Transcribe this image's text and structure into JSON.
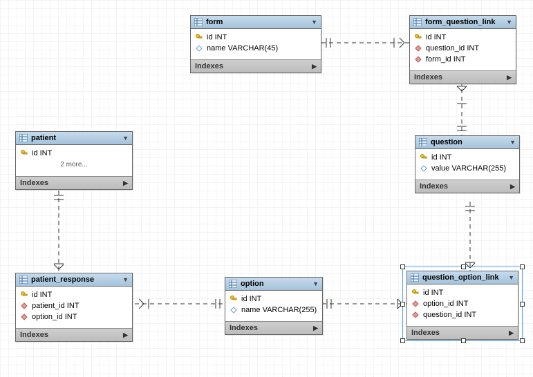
{
  "entities": {
    "form": {
      "name": "form",
      "cols": [
        {
          "sym": "key",
          "text": "id INT"
        },
        {
          "sym": "diamond",
          "text": "name VARCHAR(45)"
        }
      ]
    },
    "form_question_link": {
      "name": "form_question_link",
      "cols": [
        {
          "sym": "key",
          "text": "id INT"
        },
        {
          "sym": "fk",
          "text": "question_id INT"
        },
        {
          "sym": "fk",
          "text": "form_id INT"
        }
      ]
    },
    "patient": {
      "name": "patient",
      "cols": [
        {
          "sym": "key",
          "text": "id INT"
        }
      ],
      "more": "2 more..."
    },
    "question": {
      "name": "question",
      "cols": [
        {
          "sym": "key",
          "text": "id INT"
        },
        {
          "sym": "diamond",
          "text": "value VARCHAR(255)"
        }
      ]
    },
    "patient_response": {
      "name": "patient_response",
      "cols": [
        {
          "sym": "key",
          "text": "id INT"
        },
        {
          "sym": "fk",
          "text": "patient_id INT"
        },
        {
          "sym": "fk",
          "text": "option_id INT"
        }
      ]
    },
    "option": {
      "name": "option",
      "cols": [
        {
          "sym": "key",
          "text": "id INT"
        },
        {
          "sym": "diamond",
          "text": "name VARCHAR(255)"
        }
      ]
    },
    "question_option_link": {
      "name": "question_option_link",
      "cols": [
        {
          "sym": "key",
          "text": "id INT"
        },
        {
          "sym": "fk",
          "text": "option_id INT"
        },
        {
          "sym": "fk",
          "text": "question_id INT"
        }
      ]
    }
  },
  "labels": {
    "indexes": "Indexes"
  }
}
